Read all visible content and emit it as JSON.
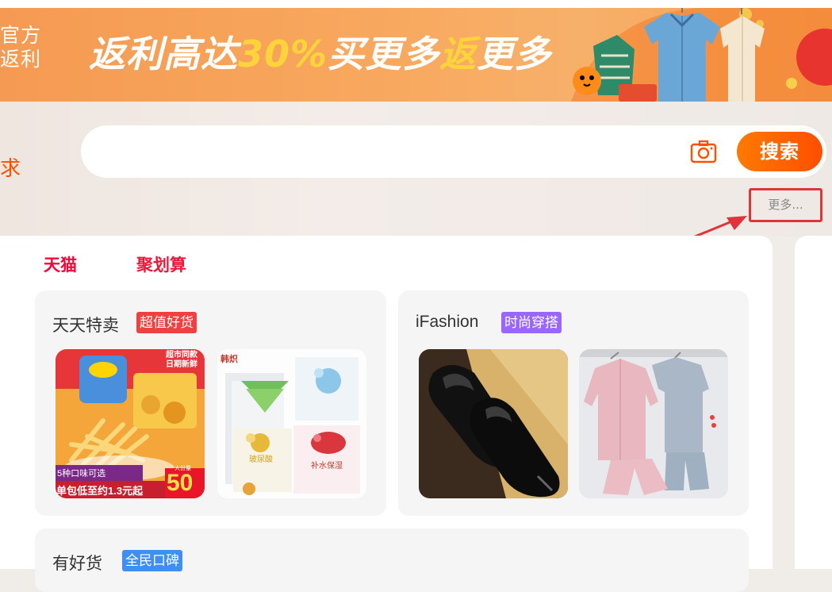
{
  "banner": {
    "side_line1": "官方",
    "side_line2": "返利",
    "slogan_a": "返利高达",
    "slogan_b": "30%",
    "slogan_c": "买更多",
    "slogan_d": "返",
    "slogan_e": "更多"
  },
  "search": {
    "left_peek": "求",
    "button_label": "搜索",
    "more_label": "更多..."
  },
  "tabs": [
    {
      "label": "天猫"
    },
    {
      "label": "聚划算"
    }
  ],
  "panels": [
    {
      "title": "天天特卖",
      "tag": "超值好货",
      "tag_color": "#f04040"
    },
    {
      "title": "iFashion",
      "tag": "时尚穿搭",
      "tag_color": "#9966ff"
    },
    {
      "title": "有好货",
      "tag": "全民口碑",
      "tag_color": "#3d8ef7"
    }
  ],
  "products": {
    "snack": {
      "badge1": "超市同款",
      "badge2": "日期新鲜",
      "tag1": "5种口味可选",
      "tag2": "单包低至约1.3元起",
      "price": "50",
      "price_label": "大份量"
    },
    "mask": {
      "brand": "韩炽",
      "label1": "玻尿酸",
      "label2": "补水保湿"
    }
  },
  "colors": {
    "accent": "#ff5000",
    "tmall": "#ff0036",
    "highlight_border": "#e0333a"
  }
}
